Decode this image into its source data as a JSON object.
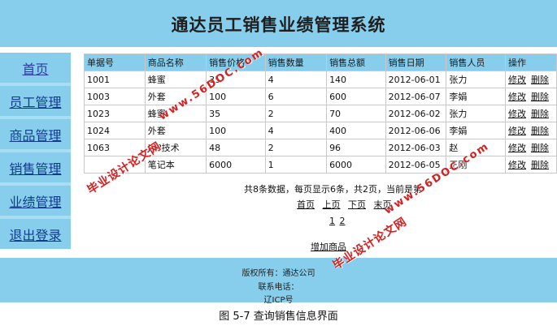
{
  "header": {
    "title": "通达员工销售业绩管理系统"
  },
  "sidebar": {
    "items": [
      {
        "label": "首页"
      },
      {
        "label": "员工管理"
      },
      {
        "label": "商品管理"
      },
      {
        "label": "销售管理"
      },
      {
        "label": "业绩管理"
      },
      {
        "label": "退出登录"
      }
    ]
  },
  "table": {
    "headers": [
      "单据号",
      "商品名称",
      "销售价格",
      "销售数量",
      "销售总额",
      "销售日期",
      "销售人员",
      "操作"
    ],
    "rows": [
      {
        "id": "1001",
        "name": "蜂蜜",
        "price": "35",
        "qty": "4",
        "total": "140",
        "date": "2012-06-01",
        "person": "张力"
      },
      {
        "id": "1003",
        "name": "外套",
        "price": "100",
        "qty": "6",
        "total": "600",
        "date": "2012-06-07",
        "person": "李娟"
      },
      {
        "id": "1023",
        "name": "蜂蜜",
        "price": "35",
        "qty": "2",
        "total": "70",
        "date": "2012-06-02",
        "person": "张力"
      },
      {
        "id": "1024",
        "name": "外套",
        "price": "100",
        "qty": "4",
        "total": "400",
        "date": "2012-06-06",
        "person": "李娟"
      },
      {
        "id": "1063",
        "name": "JSP技术",
        "price": "48",
        "qty": "2",
        "total": "96",
        "date": "2012-06-03",
        "person": "赵"
      },
      {
        "id": "",
        "name": "笔记本",
        "price": "6000",
        "qty": "1",
        "total": "6000",
        "date": "2012-06-05",
        "person": "王刚"
      }
    ],
    "edit_label": "修改",
    "delete_label": "删除"
  },
  "summary": "共8条数据，每页显示6条，共2页，当前是第",
  "pager": {
    "first": "首页",
    "prev": "上页",
    "next": "下页",
    "last": "末页"
  },
  "page_numbers": [
    "1",
    "2"
  ],
  "add_link": "增加商品",
  "footer": {
    "copyright": "版权所有：通达公司",
    "contact": "联系电话：",
    "icp": "辽ICP号"
  },
  "caption": "图 5-7  查询销售信息界面",
  "watermarks": {
    "url": "www.56DOC.com",
    "site": "毕业设计论文网"
  },
  "colors": {
    "accent": "#87cdec",
    "sidebar_bg": "#a9ddf3",
    "watermark": "#d42020"
  }
}
